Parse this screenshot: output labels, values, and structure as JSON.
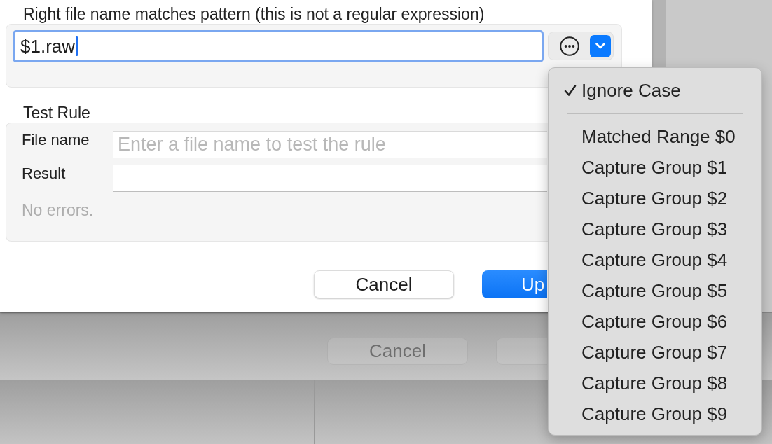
{
  "dialog": {
    "pattern_label": "Right file name matches pattern (this is not a regular expression)",
    "pattern_field": {
      "value": "$1.raw",
      "focused": true
    },
    "dropdown_button": {
      "expanded": true
    },
    "test_rule": {
      "title": "Test Rule",
      "fields": [
        {
          "label": "File name",
          "placeholder": "Enter a file name to test the rule"
        },
        {
          "label": "Result"
        }
      ],
      "status": "No errors."
    },
    "buttons": [
      {
        "label": "Cancel",
        "kind": "secondary"
      },
      {
        "label": "Up",
        "kind": "primary"
      }
    ]
  },
  "menu": {
    "options": [
      {
        "label": "Ignore Case",
        "checked": true
      }
    ],
    "items": [
      {
        "label": "Matched Range $0"
      },
      {
        "label": "Capture Group $1"
      },
      {
        "label": "Capture Group $2"
      },
      {
        "label": "Capture Group $3"
      },
      {
        "label": "Capture Group $4"
      },
      {
        "label": "Capture Group $5"
      },
      {
        "label": "Capture Group $6"
      },
      {
        "label": "Capture Group $7"
      },
      {
        "label": "Capture Group $8"
      },
      {
        "label": "Capture Group $9"
      }
    ]
  },
  "background_window": {
    "buttons": [
      {
        "label": "Cancel",
        "disabled": true
      }
    ]
  }
}
